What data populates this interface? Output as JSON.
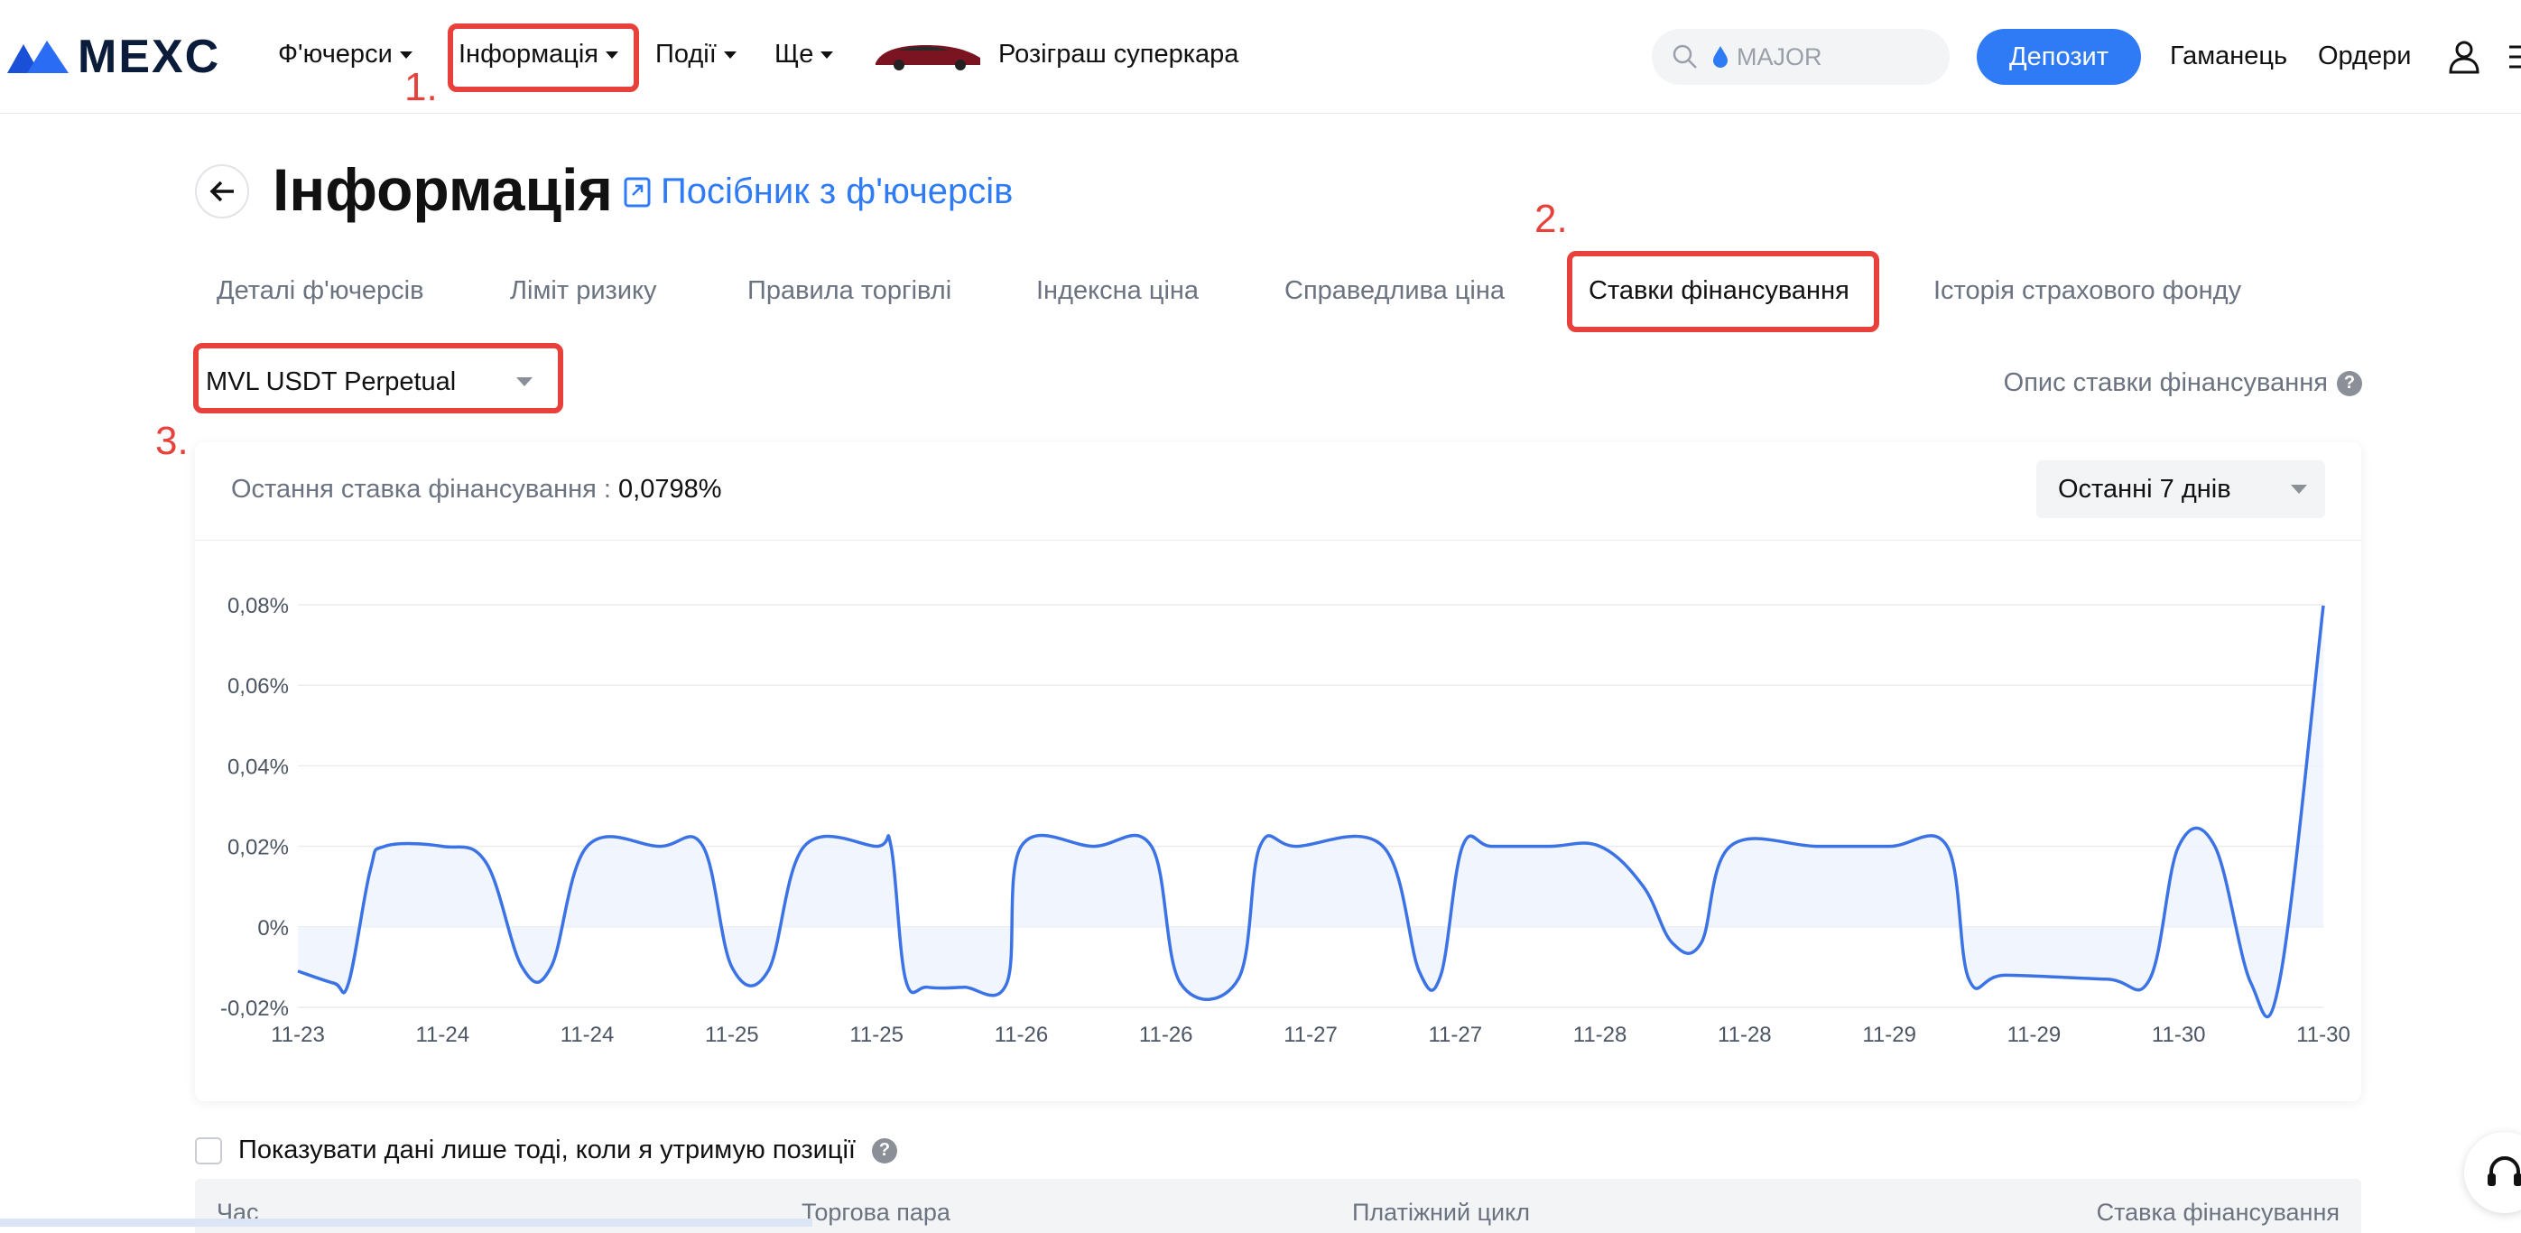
{
  "header": {
    "logo_text": "MEXC",
    "nav": [
      {
        "label": "Ф'ючерси"
      },
      {
        "label": "Інформація"
      },
      {
        "label": "Події"
      },
      {
        "label": "Ще"
      }
    ],
    "promo_label": "Розіграш суперкара",
    "search_placeholder": "MAJOR",
    "deposit_label": "Депозит",
    "wallet_label": "Гаманець",
    "orders_label": "Ордери"
  },
  "annotations": [
    "1.",
    "2.",
    "3."
  ],
  "page": {
    "title": "Інформація",
    "guide_link": "Посібник з ф'ючерсів",
    "tabs": [
      "Деталі ф'ючерсів",
      "Ліміт ризику",
      "Правила торгівлі",
      "Індексна ціна",
      "Справедлива ціна",
      "Ставки фінансування",
      "Історія страхового фонду"
    ],
    "active_tab": "Ставки фінансування",
    "contract": "MVL USDT Perpetual",
    "description_link": "Опис ставки фінансування"
  },
  "card": {
    "last_rate_label": "Остання ставка фінансування :",
    "last_rate_value": "0,0798%",
    "period": "Останні 7 днів"
  },
  "chart_data": {
    "type": "line",
    "title": "",
    "xlabel": "",
    "ylabel": "",
    "ylim": [
      -0.02,
      0.08
    ],
    "y_ticks": [
      "0,08%",
      "0,06%",
      "0,04%",
      "0,02%",
      "0%",
      "-0,02%"
    ],
    "y_tick_values": [
      0.08,
      0.06,
      0.04,
      0.02,
      0,
      -0.02
    ],
    "x_ticks": [
      "11-23",
      "11-24",
      "11-24",
      "11-25",
      "11-25",
      "11-26",
      "11-26",
      "11-27",
      "11-27",
      "11-28",
      "11-28",
      "11-29",
      "11-29",
      "11-30",
      "11-30"
    ],
    "grid": true,
    "fill": true,
    "color": "#3b73e6",
    "series": [
      {
        "x": [
          0,
          0.25,
          0.35,
          0.5,
          0.6,
          1.0,
          1.3,
          1.55,
          1.75,
          2.0,
          2.5,
          2.8,
          3.0,
          3.25,
          3.5,
          4.0,
          4.1,
          4.2,
          4.35,
          4.6,
          4.9,
          5.0,
          5.5,
          5.9,
          6.1,
          6.5,
          6.65,
          6.9,
          7.5,
          7.75,
          7.9,
          8.05,
          8.25,
          8.65,
          9.0,
          9.3,
          9.5,
          9.7,
          9.9,
          10.5,
          11.0,
          11.4,
          11.55,
          11.8,
          12.5,
          12.8,
          13.0,
          13.25,
          13.5,
          13.7,
          14.0
        ],
        "y": [
          -0.011,
          -0.014,
          -0.014,
          0.014,
          0.02,
          0.02,
          0.016,
          -0.01,
          -0.01,
          0.02,
          0.02,
          0.02,
          -0.01,
          -0.011,
          0.02,
          0.02,
          0.02,
          -0.013,
          -0.015,
          -0.015,
          -0.014,
          0.02,
          0.02,
          0.02,
          -0.014,
          -0.013,
          0.02,
          0.02,
          0.02,
          -0.011,
          -0.012,
          0.02,
          0.02,
          0.02,
          0.02,
          0.01,
          -0.004,
          -0.004,
          0.02,
          0.02,
          0.02,
          0.02,
          -0.013,
          -0.012,
          -0.013,
          -0.013,
          0.02,
          0.02,
          -0.014,
          -0.013,
          0.0798
        ]
      }
    ]
  },
  "filter_label": "Показувати дані лише тоді, коли я утримую позиції",
  "table_headers": [
    "Час",
    "Торгова пара",
    "Платіжний цикл",
    "Ставка фінансування"
  ]
}
